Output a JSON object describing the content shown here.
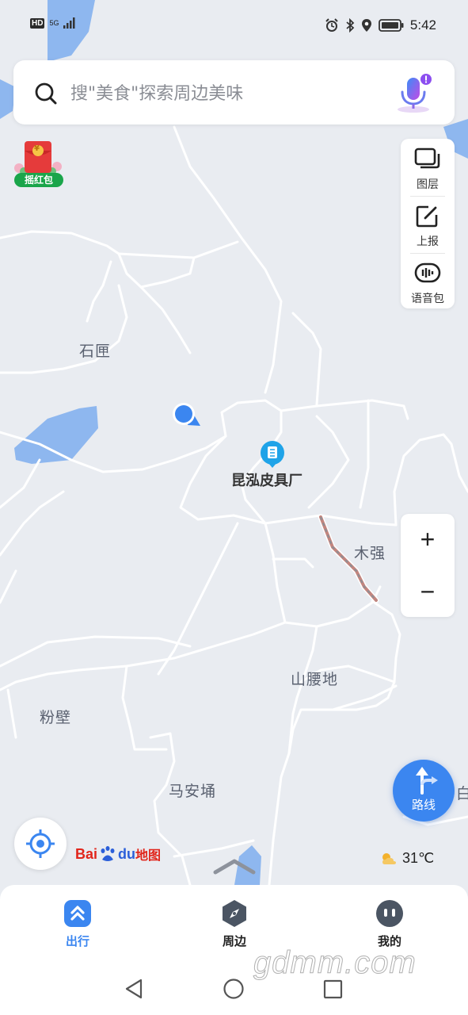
{
  "status_bar": {
    "hd": "HD",
    "signal": "5G",
    "time": "5:42"
  },
  "search": {
    "placeholder": "搜\"美食\"探索周边美味"
  },
  "red_packet": {
    "label": "摇红包",
    "symbol": "¥"
  },
  "map_tools": [
    {
      "label": "图层",
      "icon": "layers-icon"
    },
    {
      "label": "上报",
      "icon": "report-edit-icon"
    },
    {
      "label": "语音包",
      "icon": "voice-pack-icon"
    }
  ],
  "places": [
    {
      "name": "石匣"
    },
    {
      "name": "昆泓皮具厂"
    },
    {
      "name": "木强"
    },
    {
      "name": "山腰地"
    },
    {
      "name": "粉壁"
    },
    {
      "name": "马安埇"
    },
    {
      "name": "白"
    }
  ],
  "zoom": {
    "in": "+",
    "out": "−"
  },
  "route_button": {
    "label": "路线"
  },
  "logo": {
    "text_bai": "Bai",
    "text_du": "du",
    "text_ditu": "地图"
  },
  "weather": {
    "temp": "31℃"
  },
  "bottom_nav": [
    {
      "label": "出行",
      "icon": "travel-icon",
      "active": true
    },
    {
      "label": "周边",
      "icon": "compass-icon",
      "active": false
    },
    {
      "label": "我的",
      "icon": "profile-icon",
      "active": false
    }
  ],
  "watermark": "gdmm.com",
  "colors": {
    "accent": "#3b86f0",
    "map_bg": "#e9ecf1",
    "water": "#8eb7ef",
    "road": "#ffffff",
    "green": "#1aa54a"
  }
}
